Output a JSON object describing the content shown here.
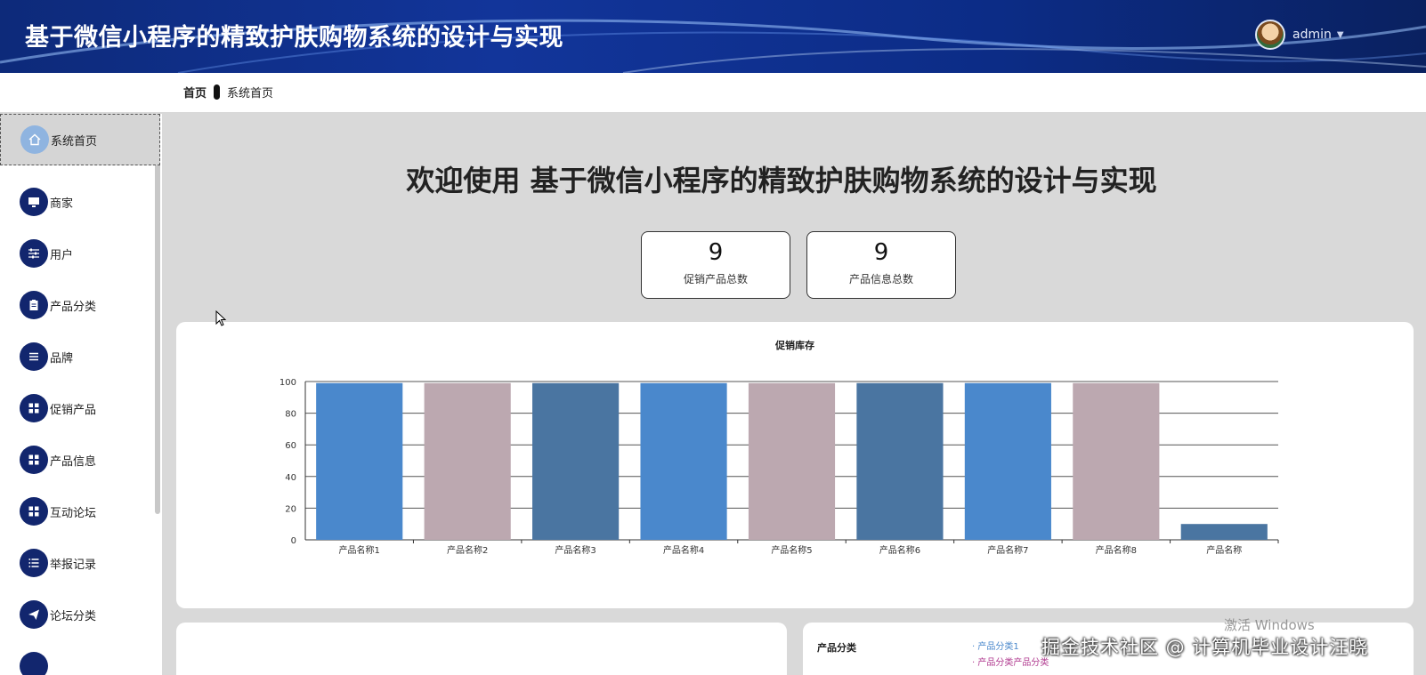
{
  "app": {
    "title": "基于微信小程序的精致护肤购物系统的设计与实现"
  },
  "user": {
    "name": "admin"
  },
  "breadcrumb": {
    "home": "首页",
    "current": "系统首页"
  },
  "sidebar": {
    "active": {
      "label": "系统首页",
      "icon": "home-icon"
    },
    "items": [
      {
        "label": "商家",
        "icon": "monitor-icon"
      },
      {
        "label": "用户",
        "icon": "sliders-icon"
      },
      {
        "label": "产品分类",
        "icon": "clipboard-icon"
      },
      {
        "label": "品牌",
        "icon": "list-icon"
      },
      {
        "label": "促销产品",
        "icon": "grid-icon"
      },
      {
        "label": "产品信息",
        "icon": "grid-icon"
      },
      {
        "label": "互动论坛",
        "icon": "grid-icon"
      },
      {
        "label": "举报记录",
        "icon": "list-check-icon"
      },
      {
        "label": "论坛分类",
        "icon": "send-icon"
      }
    ]
  },
  "welcome": "欢迎使用 基于微信小程序的精致护肤购物系统的设计与实现",
  "stats": [
    {
      "value": "9",
      "label": "促销产品总数"
    },
    {
      "value": "9",
      "label": "产品信息总数"
    }
  ],
  "chart_data": {
    "type": "bar",
    "title": "促销库存",
    "categories": [
      "产品名称1",
      "产品名称2",
      "产品名称3",
      "产品名称4",
      "产品名称5",
      "产品名称6",
      "产品名称7",
      "产品名称8",
      "产品名称"
    ],
    "values": [
      99,
      99,
      99,
      99,
      99,
      99,
      99,
      99,
      10
    ],
    "colors": [
      "#4a88cc",
      "#bca8b0",
      "#4a75a1",
      "#4a88cc",
      "#bca8b0",
      "#4a75a1",
      "#4a88cc",
      "#bca8b0",
      "#4a75a1"
    ],
    "yticks": [
      0,
      20,
      40,
      60,
      80,
      100
    ],
    "ylim": [
      0,
      100
    ],
    "grid": true,
    "xlabel": "",
    "ylabel": ""
  },
  "pie_card": {
    "title": "产品分类",
    "legend": [
      {
        "label": "产品分类1",
        "color": "#4a88cc"
      },
      {
        "label": "产品分类产品分类",
        "color": "#b03a8f"
      }
    ]
  },
  "watermark": {
    "windows": "激活 Windows",
    "csdn": "掘金技术社区 @ 计算机毕业设计汪晓"
  },
  "colors": {
    "header": "#0d2a7a",
    "nav_icon": "#12266e",
    "nav_active_icon": "#8fb4e0"
  }
}
